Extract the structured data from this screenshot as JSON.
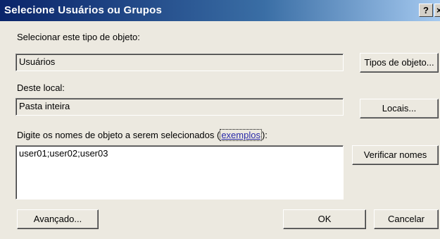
{
  "window": {
    "title": "Selecione Usuários ou Grupos",
    "help_label": "?",
    "close_label": "×"
  },
  "object_type": {
    "label": "Selecionar este tipo de objeto:",
    "value": "Usuários",
    "button_label": "Tipos de objeto..."
  },
  "location": {
    "label": "Deste local:",
    "value": "Pasta inteira",
    "button_label": "Locais..."
  },
  "names": {
    "label_prefix": "Digite os nomes de objeto a serem selecionados (",
    "examples_link": "exemplos",
    "label_suffix": "):",
    "value": "user01;user02;user03",
    "check_button_label": "Verificar nomes"
  },
  "footer": {
    "advanced_label": "Avançado...",
    "ok_label": "OK",
    "cancel_label": "Cancelar"
  },
  "colors": {
    "title_bar_start": "#0a246a",
    "title_bar_end": "#a6caf0",
    "dialog_background": "#ece9e0",
    "link": "#2a2aa8"
  }
}
